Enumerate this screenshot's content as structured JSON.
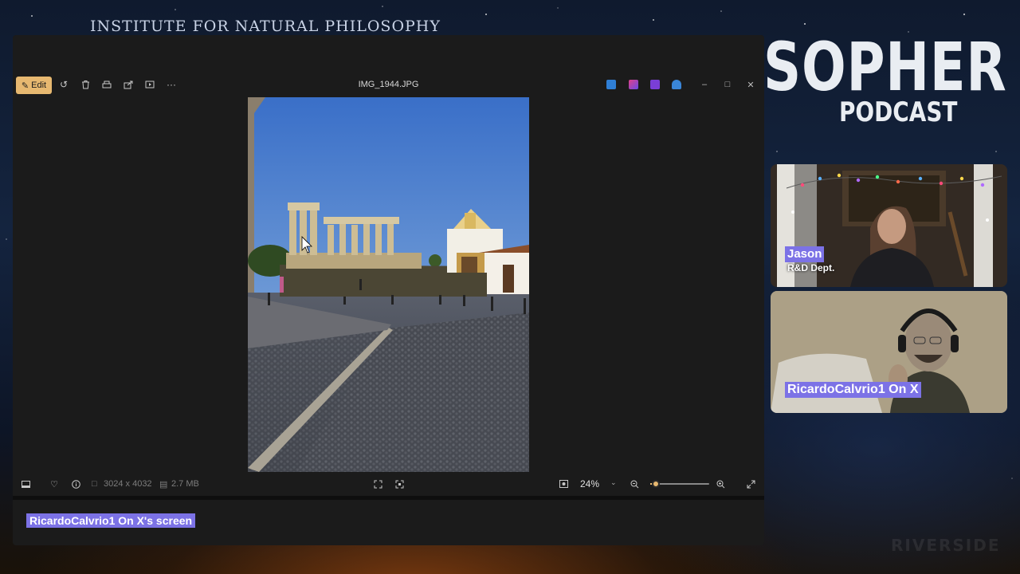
{
  "brand": {
    "title": "INSTITUTE FOR NATURAL PHILOSOPHY",
    "sopher": "SOPHER",
    "podcast": "PODCAST",
    "watermark": "RIVERSIDE"
  },
  "viewer": {
    "edit_label": "Edit",
    "filename": "IMG_1944.JPG",
    "toolbar_icons": [
      "rotate-icon",
      "delete-icon",
      "print-icon",
      "share-icon",
      "slideshow-icon",
      "more-icon"
    ],
    "app_icons": [
      "clipchamp-icon",
      "designer-icon",
      "clipchamp-purple-icon",
      "cloud-icon"
    ],
    "window_controls": [
      "minimize-icon",
      "maximize-icon",
      "close-icon"
    ],
    "status": {
      "dimensions": "3024 x 4032",
      "size": "2.7 MB",
      "zoom": "24%",
      "zoom_level": 0.1
    }
  },
  "share": {
    "label": "RicardoCalvrio1 On X's screen"
  },
  "participants": [
    {
      "name": "Jason",
      "role": "R&D Dept."
    },
    {
      "name": "RicardoCalvrio1 On X"
    }
  ],
  "colors": {
    "accent": "#e7b870",
    "tag": "#7c72e6"
  }
}
